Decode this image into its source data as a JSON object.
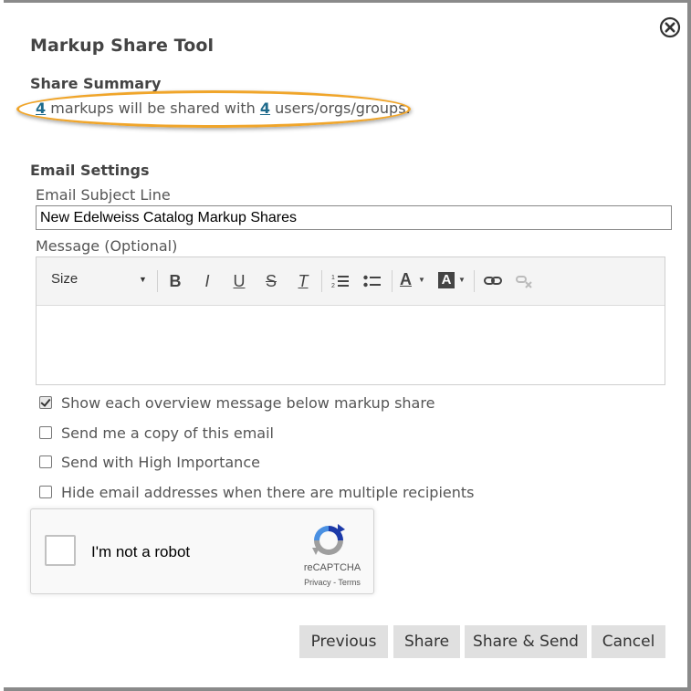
{
  "dialog": {
    "title": "Markup Share Tool",
    "close_icon": "close-circle-icon"
  },
  "share_summary": {
    "heading": "Share Summary",
    "markup_count": "4",
    "text_middle": " markups will be shared with ",
    "recipient_count": "4",
    "text_end": " users/orgs/groups.",
    "highlight_color": "#f0a52a"
  },
  "email_settings": {
    "heading": "Email Settings",
    "subject_label": "Email Subject Line",
    "subject_value": "New Edelweiss Catalog Markup Shares",
    "message_label": "Message (Optional)",
    "message_value": ""
  },
  "editor_toolbar": {
    "size_label": "Size",
    "buttons": [
      {
        "name": "bold-icon",
        "glyph": "B"
      },
      {
        "name": "italic-icon",
        "glyph": "I"
      },
      {
        "name": "underline-icon",
        "glyph": "U"
      },
      {
        "name": "strikethrough-icon",
        "glyph": "S"
      },
      {
        "name": "clear-formatting-icon",
        "glyph": "T"
      },
      {
        "name": "numbered-list-icon"
      },
      {
        "name": "bulleted-list-icon"
      },
      {
        "name": "text-color-icon",
        "glyph": "A"
      },
      {
        "name": "background-color-icon",
        "glyph": "A"
      },
      {
        "name": "link-icon"
      },
      {
        "name": "unlink-icon"
      }
    ]
  },
  "options": [
    {
      "label": "Show each overview message below markup share",
      "checked": true
    },
    {
      "label": "Send me a copy of this email",
      "checked": false
    },
    {
      "label": "Send with High Importance",
      "checked": false
    },
    {
      "label": "Hide email addresses when there are multiple recipients",
      "checked": false
    }
  ],
  "recaptcha": {
    "label": "I'm not a robot",
    "brand": "reCAPTCHA",
    "privacy": "Privacy",
    "separator": " - ",
    "terms": "Terms"
  },
  "footer": {
    "previous": "Previous",
    "share": "Share",
    "share_send": "Share & Send",
    "cancel": "Cancel"
  }
}
